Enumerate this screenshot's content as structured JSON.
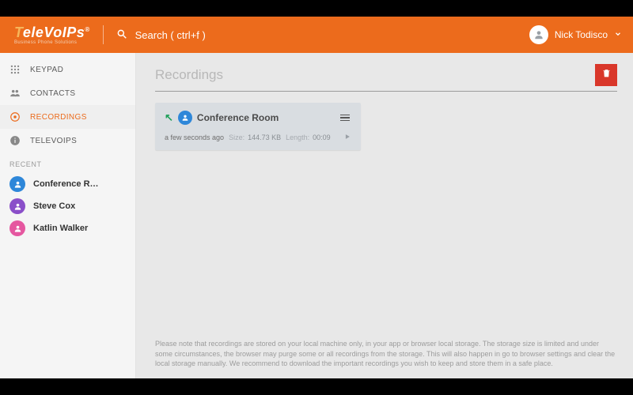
{
  "header": {
    "logo_primary": "TeleVoIPs",
    "logo_sub": "Business Phone Solutions",
    "search_label": "Search ( ctrl+f )",
    "user_name": "Nick Todisco"
  },
  "sidebar": {
    "items": [
      {
        "label": "KEYPAD",
        "icon": "keypad-icon"
      },
      {
        "label": "CONTACTS",
        "icon": "contacts-icon"
      },
      {
        "label": "RECORDINGS",
        "icon": "record-icon",
        "active": true
      },
      {
        "label": "TELEVOIPS",
        "icon": "info-icon"
      }
    ],
    "recent_heading": "RECENT",
    "recent": [
      {
        "label": "Conference R…",
        "avatar": "blue"
      },
      {
        "label": "Steve Cox",
        "avatar": "purple"
      },
      {
        "label": "Katlin Walker",
        "avatar": "pink"
      }
    ]
  },
  "main": {
    "title": "Recordings",
    "card": {
      "name": "Conference Room",
      "when": "a few seconds ago",
      "size_label": "Size:",
      "size_value": "144.73 KB",
      "length_label": "Length:",
      "length_value": "00:09"
    },
    "footer_note": "Please note that recordings are stored on your local machine only, in your app or browser local storage. The storage size is limited and under some circumstances, the browser may purge some or all recordings from the storage. This will also happen in go to browser settings and clear the local storage manually. We recommend to download the important recordings you wish to keep and store them in a safe place."
  }
}
